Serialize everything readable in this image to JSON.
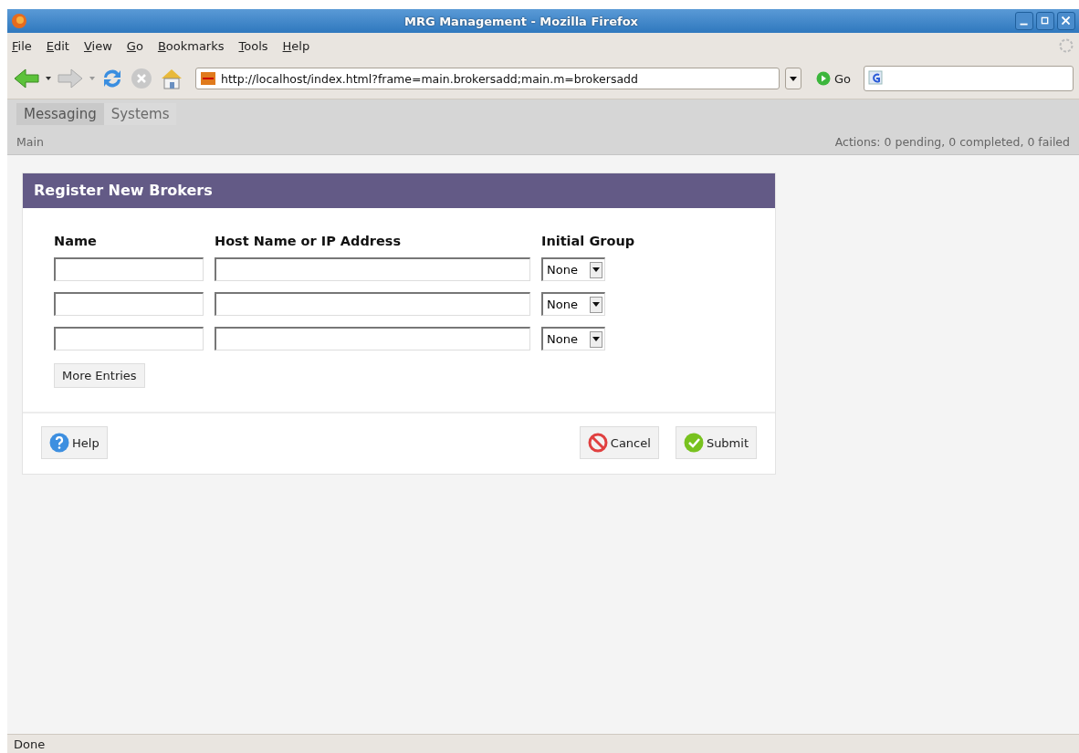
{
  "window": {
    "title": "MRG Management - Mozilla Firefox"
  },
  "menu": [
    "File",
    "Edit",
    "View",
    "Go",
    "Bookmarks",
    "Tools",
    "Help"
  ],
  "toolbar": {
    "url": "http://localhost/index.html?frame=main.brokersadd;main.m=brokersadd",
    "go": "Go"
  },
  "app": {
    "tabs": [
      {
        "label": "Messaging",
        "selected": true
      },
      {
        "label": "Systems",
        "selected": false
      }
    ],
    "breadcrumb": "Main",
    "actions": "Actions: 0 pending, 0 completed, 0 failed"
  },
  "form": {
    "title": "Register New Brokers",
    "columns": [
      "Name",
      "Host Name or IP Address",
      "Initial Group"
    ],
    "rows": [
      {
        "group": "None"
      },
      {
        "group": "None"
      },
      {
        "group": "None"
      }
    ],
    "more": "More Entries",
    "help": "Help",
    "cancel": "Cancel",
    "submit": "Submit"
  },
  "status_bar": "Done"
}
